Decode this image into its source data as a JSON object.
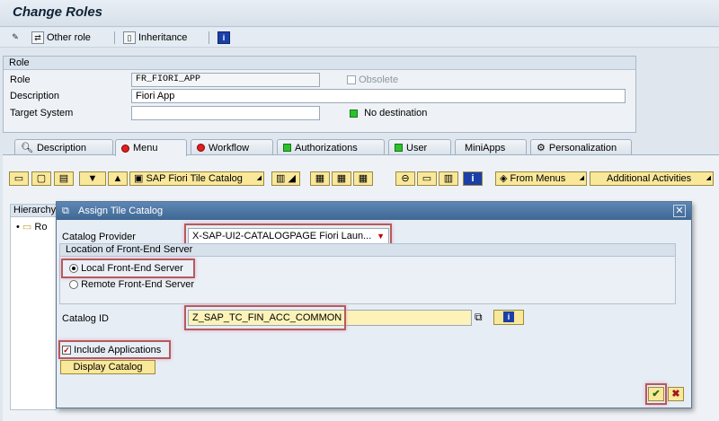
{
  "window": {
    "title": "Change Roles"
  },
  "toolbar": {
    "other_role": "Other role",
    "inheritance": "Inheritance",
    "info_icon": "info-icon"
  },
  "role_panel": {
    "header": "Role",
    "role_label": "Role",
    "role_value": "FR_FIORI_APP",
    "obsolete_label": "Obsolete",
    "description_label": "Description",
    "description_value": "Fiori App",
    "target_label": "Target System",
    "target_value": "",
    "destination_status": "No destination"
  },
  "tabs": [
    {
      "label": "Description",
      "icon": "search-icon"
    },
    {
      "label": "Menu",
      "icon": "red-status-icon"
    },
    {
      "label": "Workflow",
      "icon": "red-status-icon"
    },
    {
      "label": "Authorizations",
      "icon": "green-status-icon"
    },
    {
      "label": "User",
      "icon": "green-status-icon"
    },
    {
      "label": "MiniApps",
      "icon": ""
    },
    {
      "label": "Personalization",
      "icon": "gear-icon"
    }
  ],
  "menu_toolbar": {
    "fiori_catalog": "SAP Fiori Tile Catalog",
    "from_menus": "From Menus",
    "additional": "Additional Activities"
  },
  "tree": {
    "header": "Hierarchy",
    "node": "Ro"
  },
  "dialog": {
    "title": "Assign Tile Catalog",
    "provider_label": "Catalog Provider",
    "provider_value": "X-SAP-UI2-CATALOGPAGE Fiori Laun...",
    "location_header": "Location of Front-End Server",
    "local_label": "Local Front-End Server",
    "remote_label": "Remote Front-End Server",
    "catalog_id_label": "Catalog ID",
    "catalog_id_value": "Z_SAP_TC_FIN_ACC_COMMON",
    "include_label": "Include Applications",
    "display_button": "Display Catalog"
  },
  "colors": {
    "accent": "#3f6794",
    "highlight": "#b45b5b",
    "button_yellow": "#f9e79a"
  }
}
